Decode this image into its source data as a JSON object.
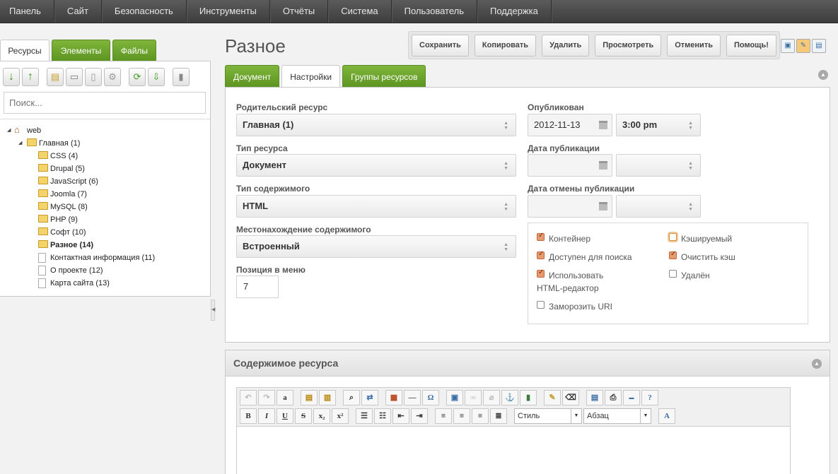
{
  "topnav": [
    "Панель",
    "Сайт",
    "Безопасность",
    "Инструменты",
    "Отчёты",
    "Система",
    "Пользователь",
    "Поддержка"
  ],
  "left": {
    "tabs": [
      "Ресурсы",
      "Элементы",
      "Файлы"
    ],
    "search_placeholder": "Поиск...",
    "tree": [
      {
        "label": "web",
        "icon": "home-icon",
        "level": 0,
        "expander": true,
        "bold": false
      },
      {
        "label": "Главная",
        "count": "(1)",
        "icon": "folder-icon",
        "level": 1,
        "expander": true,
        "bold": false
      },
      {
        "label": "CSS",
        "count": "(4)",
        "icon": "folder-icon",
        "level": 2,
        "bold": false
      },
      {
        "label": "Drupal",
        "count": "(5)",
        "icon": "folder-icon",
        "level": 2,
        "bold": false
      },
      {
        "label": "JavaScript",
        "count": "(6)",
        "icon": "folder-icon",
        "level": 2,
        "bold": false
      },
      {
        "label": "Joomla",
        "count": "(7)",
        "icon": "folder-icon",
        "level": 2,
        "bold": false
      },
      {
        "label": "MySQL",
        "count": "(8)",
        "icon": "folder-icon",
        "level": 2,
        "bold": false
      },
      {
        "label": "PHP",
        "count": "(9)",
        "icon": "folder-icon",
        "level": 2,
        "bold": false
      },
      {
        "label": "Софт",
        "count": "(10)",
        "icon": "folder-icon",
        "level": 2,
        "bold": false
      },
      {
        "label": "Разное",
        "count": "(14)",
        "icon": "folder-icon",
        "level": 2,
        "bold": true
      },
      {
        "label": "Контактная информация",
        "count": "(11)",
        "icon": "document-icon",
        "level": 1,
        "bold": false
      },
      {
        "label": "О проекте",
        "count": "(12)",
        "icon": "document-icon",
        "level": 1,
        "bold": false
      },
      {
        "label": "Карта сайта",
        "count": "(13)",
        "icon": "document-icon",
        "level": 1,
        "bold": false
      }
    ]
  },
  "main": {
    "title": "Разное",
    "actions": {
      "save": "Сохранить",
      "copy": "Копировать",
      "delete": "Удалить",
      "view": "Просмотреть",
      "cancel": "Отменить",
      "help": "Помощь!"
    },
    "tabs": [
      "Документ",
      "Настройки",
      "Группы ресурсов"
    ],
    "fields": {
      "parent_label": "Родительский ресурс",
      "parent_value": "Главная (1)",
      "type_label": "Тип ресурса",
      "type_value": "Документ",
      "content_type_label": "Тип содержимого",
      "content_type_value": "HTML",
      "disposition_label": "Местонахождение содержимого",
      "disposition_value": "Встроенный",
      "menu_index_label": "Позиция в меню",
      "menu_index_value": "7",
      "published_label": "Опубликован",
      "published_date": "2012-11-13",
      "published_time": "3:00 pm",
      "pub_date_label": "Дата публикации",
      "unpub_date_label": "Дата отмены публикации"
    },
    "checkboxes": [
      {
        "label": "Контейнер",
        "checked": true
      },
      {
        "label": "Кэшируемый",
        "checked": false
      },
      {
        "label": "Доступен для поиска",
        "checked": true
      },
      {
        "label": "Очистить кэш",
        "checked": true
      },
      {
        "label": "Использовать",
        "label2": "HTML-редактор",
        "checked": true
      },
      {
        "label": "Удалён",
        "checked": false
      },
      {
        "label": "Заморозить URI",
        "checked": false
      }
    ],
    "content_section_title": "Содержимое ресурса",
    "editor": {
      "style_select": "Стиль",
      "format_select": "Абзац"
    }
  }
}
